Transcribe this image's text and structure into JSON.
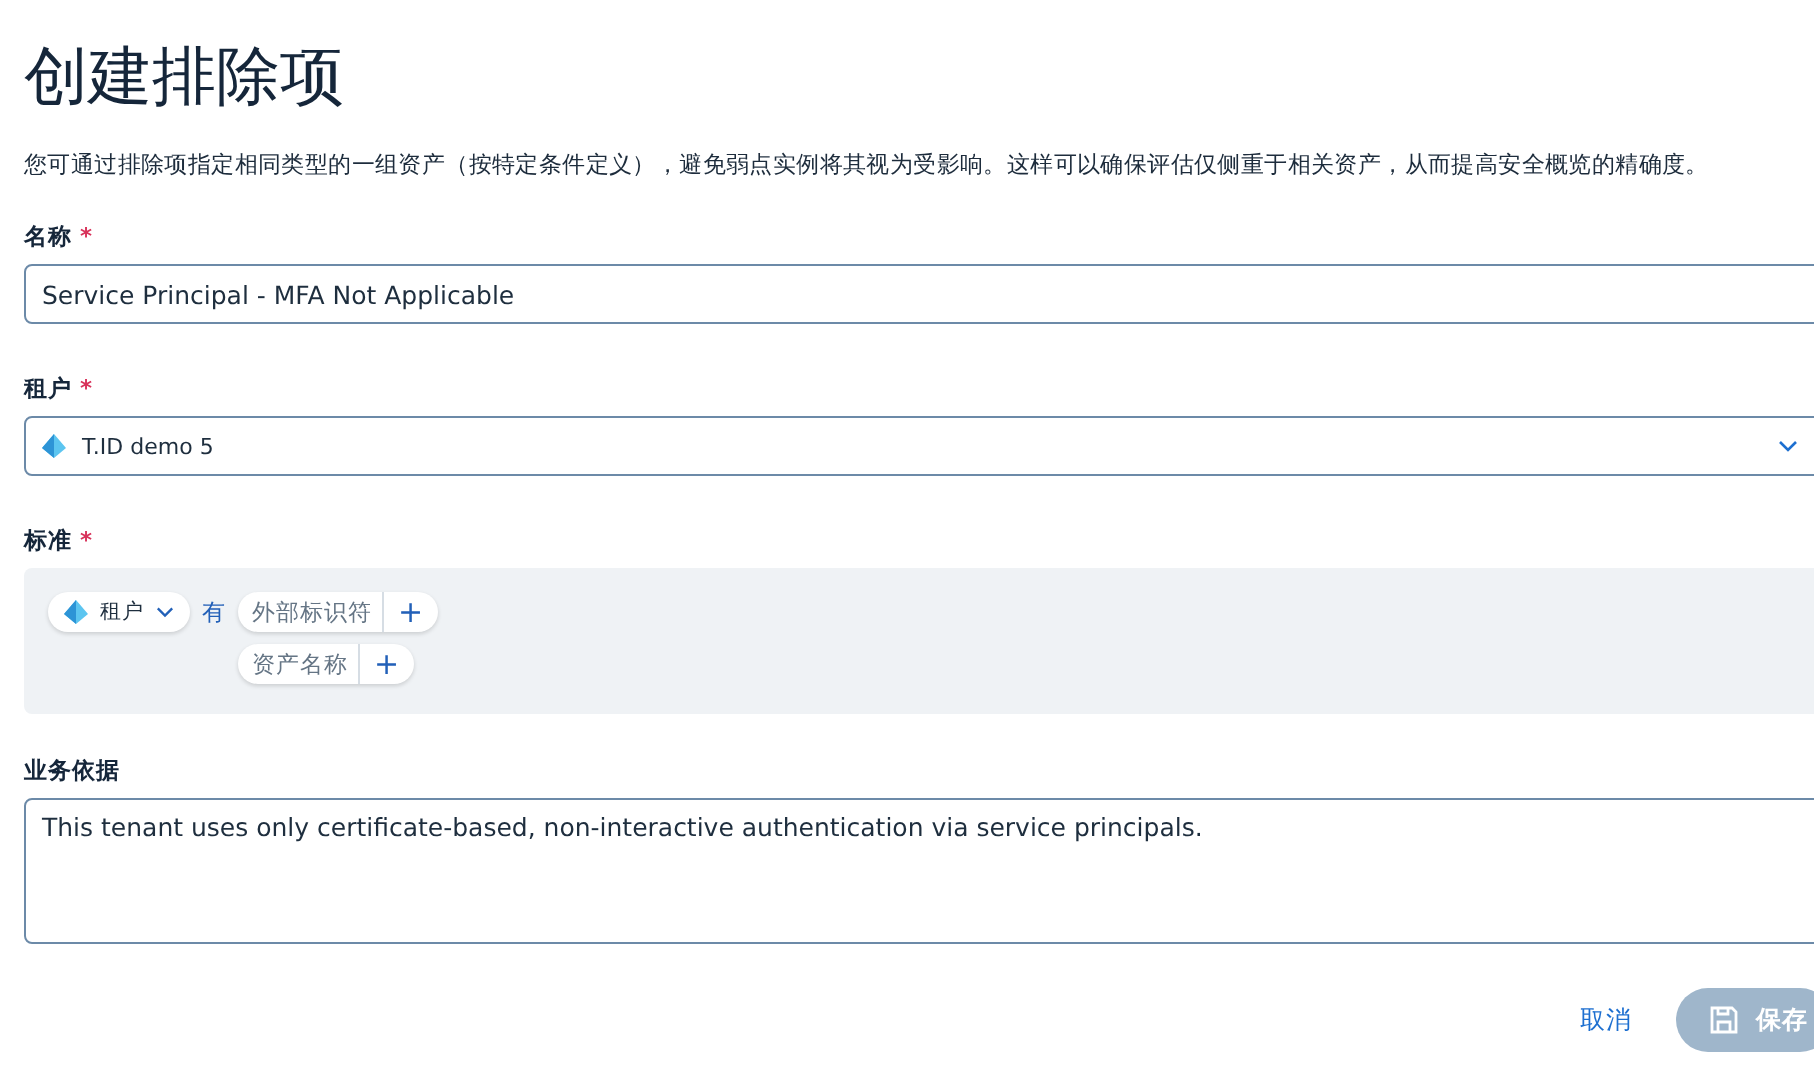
{
  "title": "创建排除项",
  "description": "您可通过排除项指定相同类型的一组资产（按特定条件定义），避免弱点实例将其视为受影响。这样可以确保评估仅侧重于相关资产，从而提高安全概览的精确度。",
  "name_field": {
    "label": "名称",
    "required_mark": "*",
    "value": "Service Principal - MFA Not Applicable"
  },
  "tenant_field": {
    "label": "租户",
    "required_mark": "*",
    "value": "T.ID demo 5"
  },
  "criteria": {
    "label": "标准",
    "required_mark": "*",
    "scope_chip": "租户",
    "connector": "有",
    "conditions": [
      {
        "label": "外部标识符",
        "add": "+"
      },
      {
        "label": "资产名称",
        "add": "+"
      }
    ]
  },
  "justification": {
    "label": "业务依据",
    "value": "This tenant uses only certificate-based, non-interactive authentication via service principals."
  },
  "buttons": {
    "cancel": "取消",
    "save": {
      "label": "保存",
      "disabled": true
    }
  }
}
